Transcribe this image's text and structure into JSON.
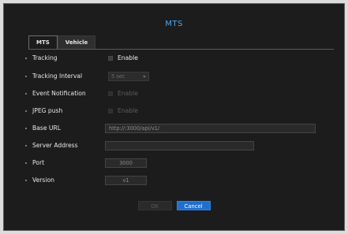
{
  "dialog": {
    "title": "MTS",
    "tabs": [
      {
        "label": "MTS",
        "active": true
      },
      {
        "label": "Vehicle",
        "active": false
      }
    ]
  },
  "fields": {
    "tracking": {
      "label": "Tracking",
      "checkbox_label": "Enable",
      "enabled": true
    },
    "tracking_interval": {
      "label": "Tracking Interval",
      "value": "5 sec"
    },
    "event_notification": {
      "label": "Event Notification",
      "checkbox_label": "Enable",
      "enabled": false
    },
    "jpeg_push": {
      "label": "JPEG push",
      "checkbox_label": "Enable",
      "enabled": false
    },
    "base_url": {
      "label": "Base URL",
      "value": "http://:3000/api/v1/"
    },
    "server_address": {
      "label": "Server Address",
      "value": ""
    },
    "port": {
      "label": "Port",
      "value": "3000"
    },
    "version": {
      "label": "Version",
      "value": "v1"
    }
  },
  "buttons": {
    "ok_label": "OK",
    "cancel_label": "Cancel"
  },
  "colors": {
    "title_accent": "#4aa7f2",
    "primary_button": "#1f6fd1",
    "dialog_background": "#1c1c1c"
  }
}
